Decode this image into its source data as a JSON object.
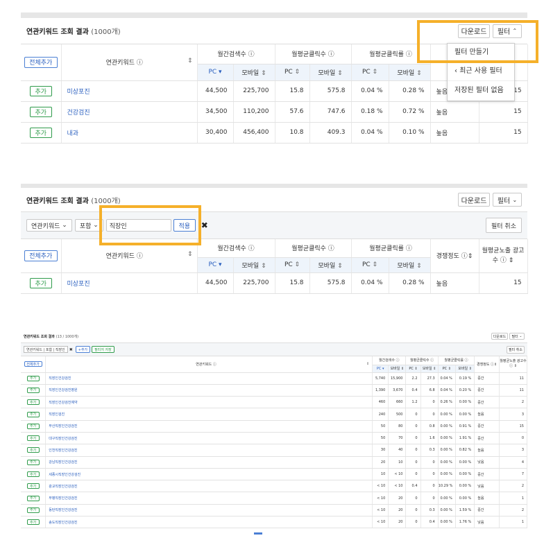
{
  "p1": {
    "title": "연관키워드 조회 결과",
    "count": "(1000개)",
    "download": "다운로드",
    "filter": "필터",
    "add_all": "전체추가",
    "col_keyword": "연관키워드",
    "col_search": "월간검색수",
    "col_click": "월평균클릭수",
    "col_ctr": "월평균클릭률",
    "col_comp": "경쟁정도",
    "pc": "PC",
    "mobile": "모바일",
    "menu": [
      "필터 만들기",
      "최근 사용 필터",
      "저장된 필터 없음"
    ],
    "rows": [
      {
        "add": "추가",
        "kw": "미상포진",
        "pc_s": "44,500",
        "mo_s": "225,700",
        "pc_c": "15.8",
        "mo_c": "575.8",
        "pc_r": "0.04 %",
        "mo_r": "0.28 %",
        "comp": "높음",
        "ads": "15"
      },
      {
        "add": "추가",
        "kw": "건강검진",
        "pc_s": "34,500",
        "mo_s": "110,200",
        "pc_c": "57.6",
        "mo_c": "747.6",
        "pc_r": "0.18 %",
        "mo_r": "0.72 %",
        "comp": "높음",
        "ads": "15"
      },
      {
        "add": "추가",
        "kw": "내과",
        "pc_s": "30,400",
        "mo_s": "456,400",
        "pc_c": "10.8",
        "mo_c": "409.3",
        "pc_r": "0.04 %",
        "mo_r": "0.10 %",
        "comp": "높음",
        "ads": "15"
      }
    ]
  },
  "p2": {
    "title": "연관키워드 조회 결과",
    "count": "(1000개)",
    "download": "다운로드",
    "filter": "필터",
    "filter_field": "연관키워드",
    "filter_op": "포함",
    "filter_value": "직장인",
    "apply": "적용",
    "cancel_filter": "필터 취소",
    "add_all": "전체추가",
    "col_keyword": "연관키워드",
    "col_search": "월간검색수",
    "col_click": "월평균클릭수",
    "col_ctr": "월평균클릭률",
    "col_comp": "경쟁정도",
    "col_ads": "월평균노출 광고수",
    "pc": "PC",
    "mobile": "모바일",
    "row": {
      "add": "추가",
      "kw": "미상포진",
      "pc_s": "44,500",
      "mo_s": "225,700",
      "pc_c": "15.8",
      "mo_c": "575.8",
      "pc_r": "0.04 %",
      "mo_r": "0.28 %",
      "comp": "높음",
      "ads": "15"
    }
  },
  "p3": {
    "title": "연관키워드 조회 결과",
    "count": "(13 / 1000개)",
    "download": "다운로드",
    "filter": "필터",
    "tag": "연관키워드 | 포함 | 직장인",
    "add_filter": "+추가",
    "save_filter": "필터저 저장",
    "cancel_filter": "필터 취소",
    "add_all": "전체추가",
    "col_keyword": "연관키워드",
    "col_search": "월간검색수",
    "col_click": "월평균클릭수",
    "col_ctr": "월평균클릭률",
    "col_comp": "경쟁정도",
    "col_ads": "월평균노출 광고수",
    "pc": "PC",
    "mobile": "모바일",
    "rows": [
      {
        "add": "추가",
        "kw": "직장인건강검진",
        "pc_s": "5,740",
        "mo_s": "15,900",
        "pc_c": "2.2",
        "mo_c": "27.3",
        "pc_r": "0.04 %",
        "mo_r": "0.19 %",
        "comp": "중간",
        "ads": "11"
      },
      {
        "add": "추가",
        "kw": "직장인건강검진병원",
        "pc_s": "1,390",
        "mo_s": "3,670",
        "pc_c": "0.4",
        "mo_c": "6.8",
        "pc_r": "0.04 %",
        "mo_r": "0.20 %",
        "comp": "중간",
        "ads": "11"
      },
      {
        "add": "추가",
        "kw": "직장인건강검진예약",
        "pc_s": "460",
        "mo_s": "660",
        "pc_c": "1.2",
        "mo_c": "0",
        "pc_r": "0.26 %",
        "mo_r": "0.00 %",
        "comp": "중간",
        "ads": "2"
      },
      {
        "add": "추가",
        "kw": "직장인검진",
        "pc_s": "240",
        "mo_s": "500",
        "pc_c": "0",
        "mo_c": "0",
        "pc_r": "0.00 %",
        "mo_r": "0.00 %",
        "comp": "높음",
        "ads": "3"
      },
      {
        "add": "추가",
        "kw": "부산직장인건강검진",
        "pc_s": "50",
        "mo_s": "80",
        "pc_c": "0",
        "mo_c": "0.8",
        "pc_r": "0.00 %",
        "mo_r": "0.91 %",
        "comp": "중간",
        "ads": "15"
      },
      {
        "add": "추가",
        "kw": "대구직장인건강검진",
        "pc_s": "50",
        "mo_s": "70",
        "pc_c": "0",
        "mo_c": "1.6",
        "pc_r": "0.00 %",
        "mo_r": "1.91 %",
        "comp": "중간",
        "ads": "0"
      },
      {
        "add": "추가",
        "kw": "인천직장인건강검진",
        "pc_s": "30",
        "mo_s": "40",
        "pc_c": "0",
        "mo_c": "0.3",
        "pc_r": "0.00 %",
        "mo_r": "0.82 %",
        "comp": "높음",
        "ads": "3"
      },
      {
        "add": "추가",
        "kw": "강남직장인건강검진",
        "pc_s": "20",
        "mo_s": "10",
        "pc_c": "0",
        "mo_c": "0",
        "pc_r": "0.00 %",
        "mo_r": "0.00 %",
        "comp": "낮음",
        "ads": "4"
      },
      {
        "add": "추가",
        "kw": "세종시직장인건강검진",
        "pc_s": "10",
        "mo_s": "< 10",
        "pc_c": "0",
        "mo_c": "0",
        "pc_r": "0.00 %",
        "mo_r": "0.00 %",
        "comp": "중간",
        "ads": "7"
      },
      {
        "add": "추가",
        "kw": "광교직장인건강검진",
        "pc_s": "< 10",
        "mo_s": "< 10",
        "pc_c": "0.4",
        "mo_c": "0",
        "pc_r": "10.29 %",
        "mo_r": "0.00 %",
        "comp": "낮음",
        "ads": "2"
      },
      {
        "add": "추가",
        "kw": "부평직장인건강검진",
        "pc_s": "< 10",
        "mo_s": "20",
        "pc_c": "0",
        "mo_c": "0",
        "pc_r": "0.00 %",
        "mo_r": "0.00 %",
        "comp": "높음",
        "ads": "1"
      },
      {
        "add": "추가",
        "kw": "동탄직장인건강검진",
        "pc_s": "< 10",
        "mo_s": "20",
        "pc_c": "0",
        "mo_c": "0.3",
        "pc_r": "0.00 %",
        "mo_r": "1.59 %",
        "comp": "중간",
        "ads": "2"
      },
      {
        "add": "추가",
        "kw": "송도직장인건강검진",
        "pc_s": "< 10",
        "mo_s": "20",
        "pc_c": "0",
        "mo_c": "0.4",
        "pc_r": "0.00 %",
        "mo_r": "1.76 %",
        "comp": "낮음",
        "ads": "1"
      }
    ]
  },
  "colors": {
    "highlight": "#f5b02a",
    "link": "#2a5fbf",
    "add_green": "#2e9b4a",
    "subhead": "#eef4fb"
  }
}
